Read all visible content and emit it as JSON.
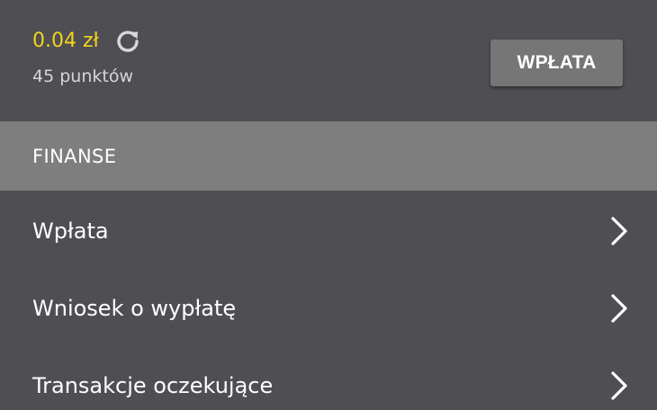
{
  "balance": {
    "amount": "0.04 zł",
    "points": "45 punktów",
    "deposit_button_label": "WPŁATA",
    "refresh_icon": "refresh-icon"
  },
  "section": {
    "title": "FINANSE"
  },
  "menu": {
    "items": [
      {
        "label": "Wpłata",
        "icon": "chevron-right-icon"
      },
      {
        "label": "Wniosek o wypłatę",
        "icon": "chevron-right-icon"
      },
      {
        "label": "Transakcje oczekujące",
        "icon": "chevron-right-icon"
      }
    ]
  },
  "colors": {
    "background": "#4f4e53",
    "section_header": "#7e7e7e",
    "button": "#767676",
    "balance_accent": "#f3d31d",
    "primary_text": "#ffffff",
    "secondary_text": "#d6d6d8"
  }
}
